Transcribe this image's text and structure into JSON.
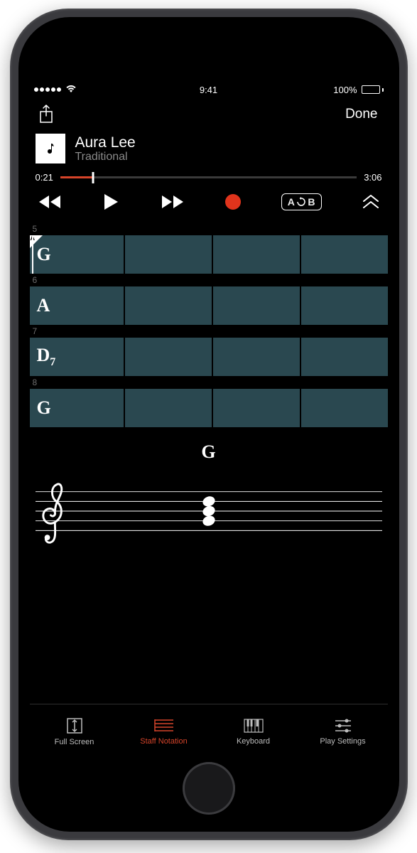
{
  "status_bar": {
    "time": "9:41",
    "battery_pct": "100%"
  },
  "nav": {
    "done_label": "Done"
  },
  "song": {
    "title": "Aura Lee",
    "subtitle": "Traditional"
  },
  "progress": {
    "elapsed": "0:21",
    "total": "3:06",
    "pct": 11
  },
  "transport": {
    "ab_label_a": "A",
    "ab_label_b": "B"
  },
  "chords": {
    "rows": [
      {
        "bar": "5",
        "label": "G",
        "subscript": "",
        "marker": "A",
        "playhead": true
      },
      {
        "bar": "6",
        "label": "A",
        "subscript": "",
        "marker": "",
        "playhead": false
      },
      {
        "bar": "7",
        "label": "D",
        "subscript": "7",
        "marker": "",
        "playhead": false
      },
      {
        "bar": "8",
        "label": "G",
        "subscript": "",
        "marker": "",
        "playhead": false
      }
    ],
    "current_label": "G"
  },
  "tabs": {
    "full_screen": "Full Screen",
    "staff_notation": "Staff Notation",
    "keyboard": "Keyboard",
    "play_settings": "Play Settings",
    "active": "staff_notation"
  }
}
